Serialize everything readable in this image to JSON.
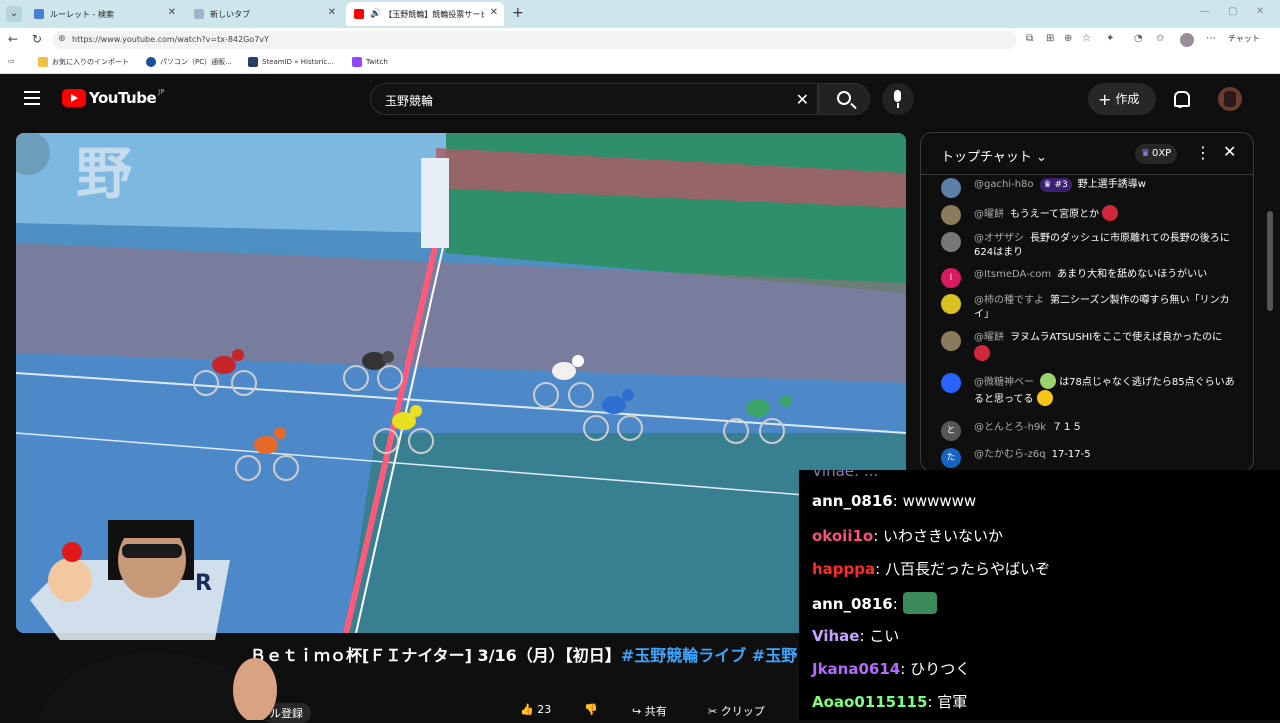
{
  "browser": {
    "tabs": [
      {
        "label": "ルーレット - 検索",
        "x": 0
      },
      {
        "label": "新しいタブ",
        "x": 0
      },
      {
        "label": "【玉野競輪】競輪投票サービスB",
        "x": 0
      }
    ],
    "url": "https://www.youtube.com/watch?v=tx-842Go7vY",
    "chat_label": "チャット",
    "bookmarks": [
      "お気に入りのインポート",
      "パソコン（PC）通販...",
      "SteamID » Historic...",
      "Twitch"
    ]
  },
  "youtube": {
    "logo_text": "YouTube",
    "region": "JP",
    "search_query": "玉野競輪",
    "create_label": "作成"
  },
  "chat": {
    "title": "トップチャット",
    "xp": "0XP",
    "messages": [
      {
        "author": "@gachi-h8o",
        "badge": "#3",
        "text": "野上選手誘導w",
        "avatar_color": "#5b7fa6"
      },
      {
        "author": "@曜餅",
        "text": "もうえーて宮原とか",
        "avatar_color": "#8c7a5c"
      },
      {
        "author": "@オザザシ",
        "text": "長野のダッシュに市原離れての長野の後ろに624はまり",
        "avatar_color": "#777777"
      },
      {
        "author": "@ItsmeDA-com",
        "avatar_letter": "I",
        "text": "あまり大和を舐めないほうがいい",
        "avatar_color": "#d81b60"
      },
      {
        "author": "@柿の種ですよ",
        "text": "第二シーズン製作の噂すら無い「リンカイ」",
        "avatar_color": "#d8c020"
      },
      {
        "author": "@曜餅",
        "text": "ヲヌムラATSUSHIをここで使えば良かったのに",
        "avatar_color": "#8c7a5c"
      },
      {
        "author": "@微糖神ベー",
        "text": "は78点じゃなく逃げたら85点ぐらいあると思ってる",
        "avatar_color": "#2962ff"
      },
      {
        "author": "@とんとろ-h9k",
        "avatar_letter": "と",
        "text": "７１５",
        "avatar_color": "#555555"
      },
      {
        "author": "@たかむら-z6q",
        "avatar_letter": "た",
        "text": "17-17-5",
        "avatar_color": "#1565c0"
      }
    ]
  },
  "video": {
    "title_main": "Ｂｅｔｉｍｏ杯[ＦＩナイター] 3/16（月）【初日】",
    "title_tags": "#玉野競輪ライブ #玉野"
  },
  "actions": {
    "likes": "23",
    "share": "共有",
    "clip": "クリップ",
    "subscribe": "ル登録"
  },
  "overlay_chat": [
    {
      "user": "ann_0816",
      "color": "#ffffff",
      "text": "wwwwww"
    },
    {
      "user": "okoii1o",
      "color": "#ff4f7b",
      "text": "いわさきいないか"
    },
    {
      "user": "happpa",
      "color": "#ff2a2a",
      "text": "八百長だったらやばいぞ"
    },
    {
      "user": "ann_0816",
      "color": "#ffffff",
      "text": ""
    },
    {
      "user": "Vihae",
      "color": "#c7a2ff",
      "text": "こい"
    },
    {
      "user": "Jkana0614",
      "color": "#b46bff",
      "text": "ひりつく"
    },
    {
      "user": "Aoao0115115",
      "color": "#7cff7c",
      "text": "官軍"
    }
  ]
}
